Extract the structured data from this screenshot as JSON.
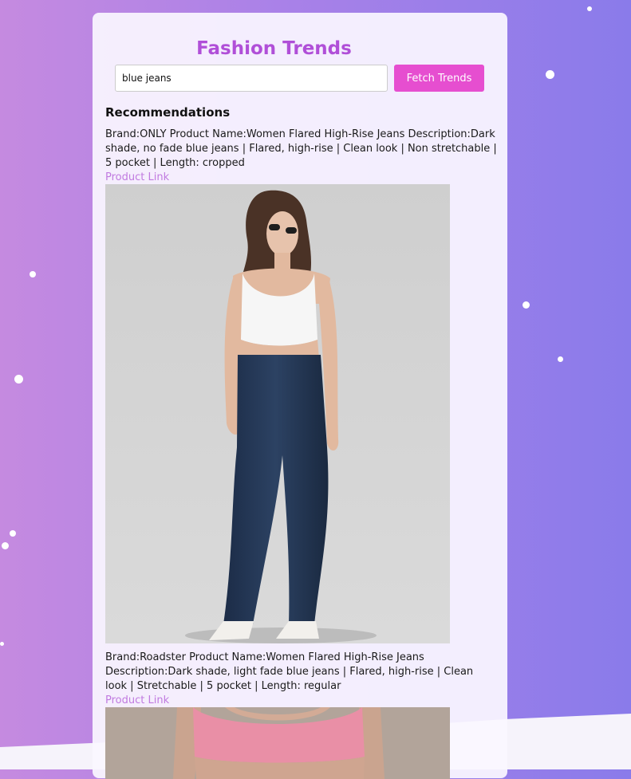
{
  "app": {
    "title": "Fashion Trends"
  },
  "search": {
    "value": "blue jeans",
    "button_label": "Fetch Trends"
  },
  "recommendations": {
    "heading": "Recommendations",
    "items": [
      {
        "text": "Brand:ONLY Product Name:Women Flared High-Rise Jeans Description:Dark shade, no fade blue jeans | Flared, high-rise | Clean look | Non stretchable | 5 pocket | Length: cropped",
        "link_label": "Product Link"
      },
      {
        "text": "Brand:Roadster Product Name:Women Flared High-Rise Jeans Description:Dark shade, light fade blue jeans | Flared, high-rise | Clean look | Stretchable | 5 pocket | Length: regular",
        "link_label": "Product Link"
      }
    ]
  },
  "colors": {
    "accent": "#b04fd8",
    "button": "#e64ed0",
    "link": "#c07ae0"
  }
}
